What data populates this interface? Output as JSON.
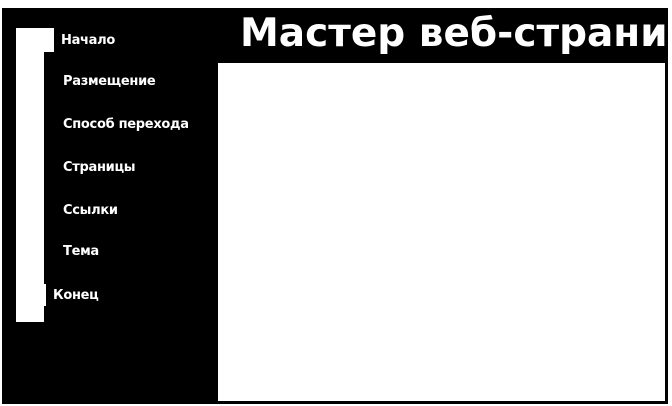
{
  "wizard": {
    "title": "Мастер веб-страниц",
    "steps": [
      {
        "label": "Начало"
      },
      {
        "label": "Размещение"
      },
      {
        "label": "Способ перехода"
      },
      {
        "label": "Страницы"
      },
      {
        "label": "Ссылки"
      },
      {
        "label": "Тема"
      },
      {
        "label": "Конец"
      }
    ]
  },
  "colors": {
    "background": "#000000",
    "text": "#ffffff",
    "content": "#ffffff"
  }
}
